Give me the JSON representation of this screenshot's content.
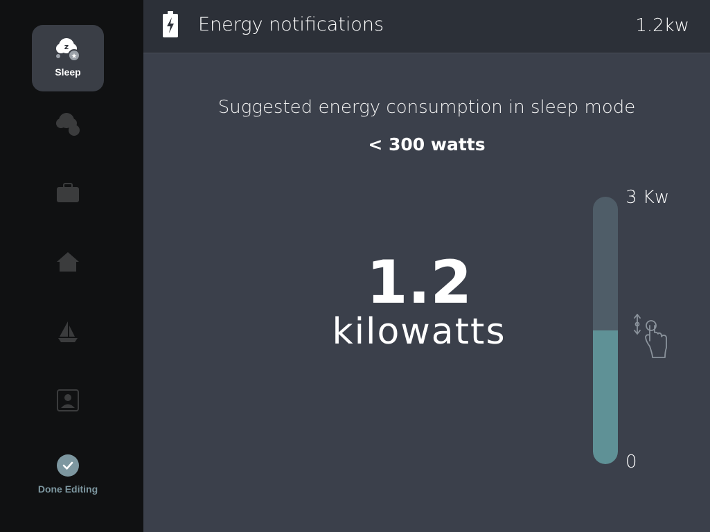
{
  "sidebar": {
    "modes": [
      {
        "label": "Sleep",
        "icon": "sleep-cloud-icon",
        "active": true
      },
      {
        "label": "",
        "icon": "sleep-cloud-icon",
        "active": false
      },
      {
        "label": "",
        "icon": "briefcase-icon",
        "active": false
      },
      {
        "label": "",
        "icon": "home-icon",
        "active": false
      },
      {
        "label": "",
        "icon": "sailboat-icon",
        "active": false
      },
      {
        "label": "",
        "icon": "person-icon",
        "active": false
      }
    ],
    "done_label": "Done Editing"
  },
  "header": {
    "title": "Energy notifications",
    "value": "1.2kw",
    "icon": "battery-charging-icon"
  },
  "main": {
    "suggestion": "Suggested energy consumption in sleep mode",
    "threshold": "< 300 watts",
    "value": "1.2",
    "unit": "kilowatts"
  },
  "slider": {
    "max_label": "3 Kw",
    "min_label": "0",
    "level_fraction": 0.5,
    "track_color": "#4f5d68",
    "fill_color": "#5f9196"
  }
}
